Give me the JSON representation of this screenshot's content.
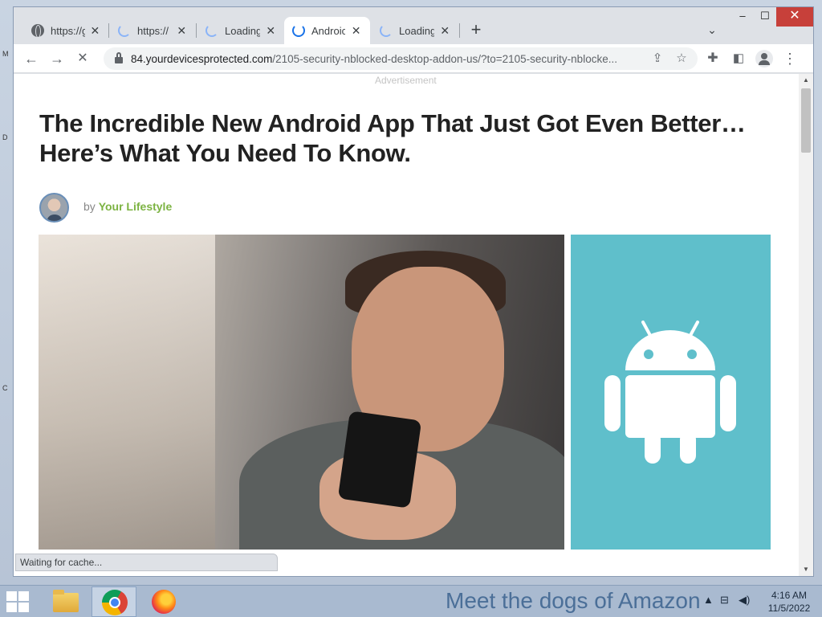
{
  "browser": {
    "tabs": [
      {
        "label": "https://g",
        "icon": "globe-icon",
        "active": false
      },
      {
        "label": "https://",
        "icon": "loading-spinner-icon",
        "active": false
      },
      {
        "label": "Loading",
        "icon": "loading-spinner-icon",
        "active": false
      },
      {
        "label": "Androic",
        "icon": "loading-spinner-icon",
        "active": true
      },
      {
        "label": "Loading",
        "icon": "loading-spinner-icon",
        "active": false
      }
    ],
    "new_tab_symbol": "+",
    "tab_search_symbol": "⌄",
    "window_controls": {
      "minimize": "‒",
      "maximize": "☐",
      "close": "✕"
    },
    "nav": {
      "back": "←",
      "forward": "→",
      "stop_reload": "✕"
    },
    "address": {
      "domain": "84.yourdevicesprotected.com",
      "path": "/2105-security-nblocked-desktop-addon-us/?to=2105-security-nblocke..."
    },
    "status_text": "Waiting for cache..."
  },
  "page": {
    "ad_label": "Advertisement",
    "headline_line1": "The Incredible New Android App That Just Got Even Better…",
    "headline_line2": "Here’s What You Need To Know.",
    "by": "by",
    "author": "Your Lifestyle",
    "colors": {
      "author": "#7cb342",
      "android_panel": "#5fbfcb"
    }
  },
  "taskbar": {
    "apps": [
      "file-explorer",
      "chrome",
      "firefox"
    ],
    "banner_text": "Meet the dogs of Amazon",
    "time": "4:16 AM",
    "date": "11/5/2022"
  },
  "desktop": {
    "edge_letters": [
      "M",
      "D",
      "C"
    ]
  }
}
